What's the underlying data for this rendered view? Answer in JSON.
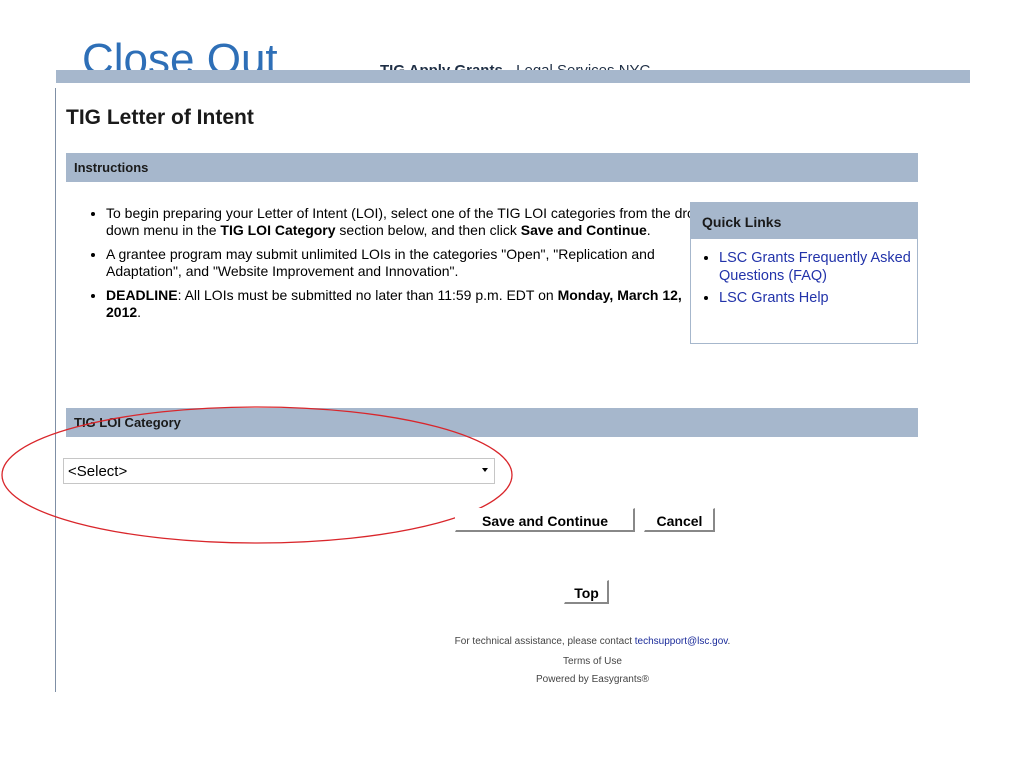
{
  "slide": {
    "title": "Close      Out"
  },
  "header": {
    "app_name": "TIG Apply Grants",
    "separator": "-",
    "org": "Legal Services NYC"
  },
  "page_title": "TIG Letter of Intent",
  "instructions": {
    "title": "Instructions",
    "item1_prefix": "To begin preparing your Letter of Intent (LOI), select one of the TIG LOI categories from the drop down menu in the ",
    "item1_bold1": "TIG LOI Category",
    "item1_middle": " section below, and then click ",
    "item1_bold2": "Save and Continue",
    "item1_suffix": ".",
    "item2": "A grantee program may submit unlimited LOIs in the categories \"Open\", \"Replication and Adaptation\", and \"Website Improvement and Innovation\".",
    "item3_bold1": "DEADLINE",
    "item3_middle": ": All LOIs must be submitted no later than 11:59 p.m. EDT on ",
    "item3_bold2": "Monday, March 12, 2012",
    "item3_suffix": "."
  },
  "quick_links": {
    "title": "Quick Links",
    "items": [
      {
        "label": "LSC Grants Frequently Asked Questions (FAQ)"
      },
      {
        "label": "LSC Grants Help"
      }
    ]
  },
  "category": {
    "title": "TIG LOI Category",
    "selected": "<Select>"
  },
  "buttons": {
    "save": "Save and Continue",
    "cancel": "Cancel",
    "top": "Top"
  },
  "footer": {
    "assist_prefix": "For technical assistance, please contact ",
    "email": "techsupport@lsc.gov",
    "assist_suffix": ".",
    "terms": "Terms of Use",
    "powered": "Powered by Easygrants®"
  },
  "colors": {
    "section_bar": "#a6b7cc",
    "link": "#2233aa",
    "annotation": "#d9262b"
  }
}
